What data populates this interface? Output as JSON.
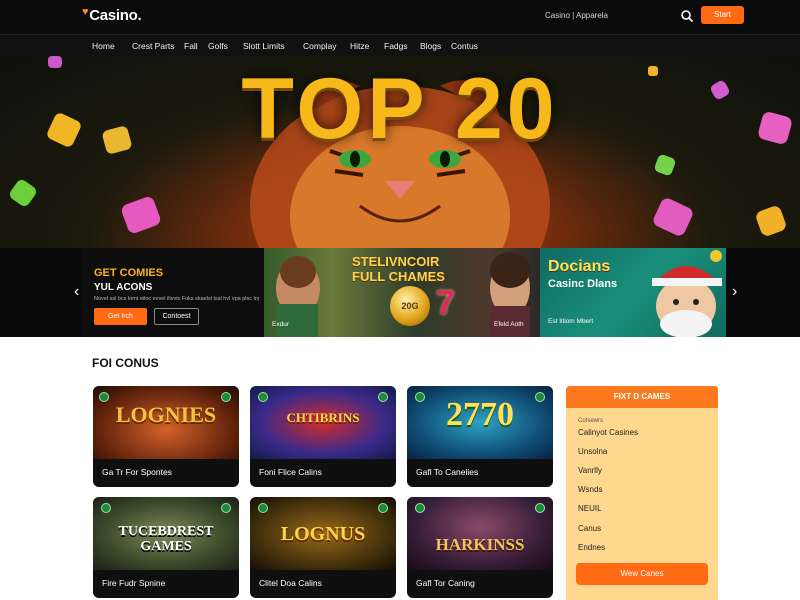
{
  "header": {
    "logo_text": "Casino.",
    "top_link": "Casino | Apparela",
    "button_label": "Start"
  },
  "nav": {
    "items": [
      "Home",
      "Crest Parts",
      "Fall",
      "Golfs",
      "Slott Limits",
      "Complay",
      "Hitze",
      "Fadgs",
      "Blogs",
      "Contus"
    ]
  },
  "hero": {
    "title": "TOP 20"
  },
  "promo": {
    "heading": "GET COMIES",
    "subheading": "YUL ACONS",
    "small_text": "Novel ssl bcs lomt eiloc evvel ilivvis Foks skaelsi tssl hvl vpa plsc lng",
    "primary_button": "Get Irch",
    "secondary_button": "Contoest",
    "mid_card": {
      "title_line1": "STELIVNCOIR",
      "title_line2": "FULL CHAMES",
      "coin_text": "20G",
      "seven": "7",
      "caption_left": "Exdur",
      "caption_right": "Efeld Aoth"
    },
    "right_card": {
      "title_line1": "Docians",
      "title_line2": "Casinc Dlans",
      "caption": "Est Iltiom Mbert"
    }
  },
  "section": {
    "title": "FOI CONUS"
  },
  "tiles": [
    {
      "logo": "LOGNIES",
      "label": "Ga Tr For Spontes"
    },
    {
      "logo": "CHTIBRINS",
      "label": "Foni Flice Calins"
    },
    {
      "logo": "2770",
      "label": "Gafl To Canelies"
    },
    {
      "logo": "TUCEBDREST GAMES",
      "label": "Fire Fudr Spnine"
    },
    {
      "logo": "LOGNUS",
      "label": "Clitel Doa Calins"
    },
    {
      "logo": "HARKINSS",
      "label": "Gafl Tor Caning"
    }
  ],
  "sidebar": {
    "heading": "FIXT D CAMES",
    "small": "Cotsewrs",
    "items": [
      "Calinyot Casines",
      "Unsolna",
      "Vanrlly",
      "Wsnds",
      "NEUIL",
      "Canus",
      "Endnes"
    ],
    "button": "Wew Canes"
  },
  "colors": {
    "accent": "#ff6a13",
    "header_bg": "#0b0b0b",
    "hero_title": "#f7b81a",
    "sidebar_bg": "#ffd88f",
    "sidebar_head": "#ff7a1f"
  }
}
